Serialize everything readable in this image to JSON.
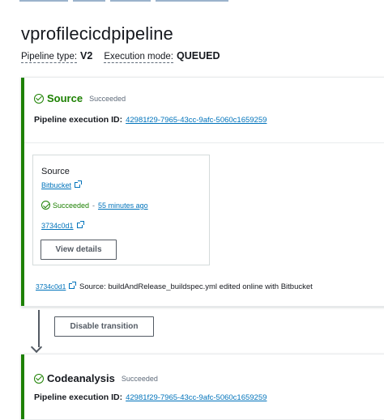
{
  "pipeline": {
    "name": "vprofilecicdpipeline",
    "type_label": "Pipeline type:",
    "type_value": "V2",
    "mode_label": "Execution mode:",
    "mode_value": "QUEUED"
  },
  "stages": {
    "source": {
      "name": "Source",
      "status": "Succeeded",
      "exec_label": "Pipeline execution ID:",
      "exec_id": "42981f29-7965-43cc-9afc-5060c1659259",
      "action": {
        "title": "Source",
        "provider": "Bitbucket",
        "status": "Succeeded",
        "separator": "-",
        "time": "55 minutes ago",
        "commit": "3734c0d1",
        "button": "View details"
      },
      "summary_commit": "3734c0d1",
      "summary_text": "Source: buildAndRelease_buildspec.yml edited online with Bitbucket"
    },
    "transition": {
      "button": "Disable transition"
    },
    "codeanalysis": {
      "name": "Codeanalysis",
      "status": "Succeeded",
      "exec_label": "Pipeline execution ID:",
      "exec_id": "42981f29-7965-43cc-9afc-5060c1659259"
    }
  },
  "icons": {
    "success": "check-circle-icon",
    "external": "external-link-icon",
    "flow": "arrow-down-icon"
  },
  "colors": {
    "success": "#1d8102",
    "link": "#0073bb",
    "text": "#16191f"
  }
}
